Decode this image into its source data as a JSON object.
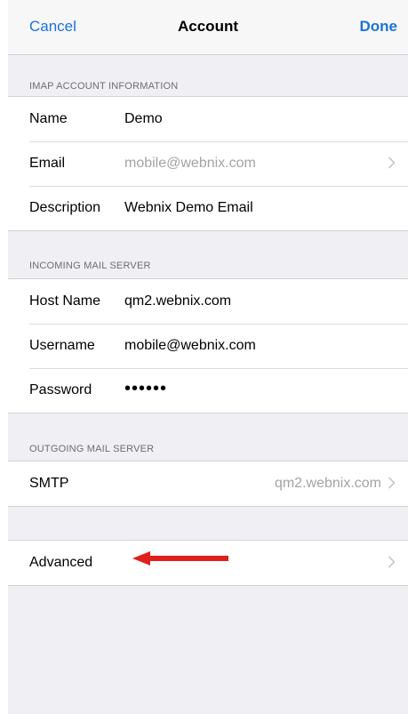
{
  "nav": {
    "cancel": "Cancel",
    "title": "Account",
    "done": "Done"
  },
  "imap": {
    "header": "IMAP ACCOUNT INFORMATION",
    "rows": [
      {
        "label": "Name",
        "value": "Demo"
      },
      {
        "label": "Email",
        "value": "mobile@webnix.com"
      },
      {
        "label": "Description",
        "value": "Webnix Demo Email"
      }
    ]
  },
  "incoming": {
    "header": "INCOMING MAIL SERVER",
    "rows": [
      {
        "label": "Host Name",
        "value": "qm2.webnix.com"
      },
      {
        "label": "Username",
        "value": "mobile@webnix.com"
      },
      {
        "label": "Password",
        "value": "••••••"
      }
    ]
  },
  "outgoing": {
    "header": "OUTGOING MAIL SERVER",
    "rows": [
      {
        "label": "SMTP",
        "value": "qm2.webnix.com"
      }
    ]
  },
  "advanced": {
    "label": "Advanced"
  },
  "annotation": {
    "arrow_color": "#e0201b"
  },
  "colors": {
    "accent": "#1a73d9",
    "background": "#efeff4",
    "muted_text": "#a3a3a8"
  }
}
